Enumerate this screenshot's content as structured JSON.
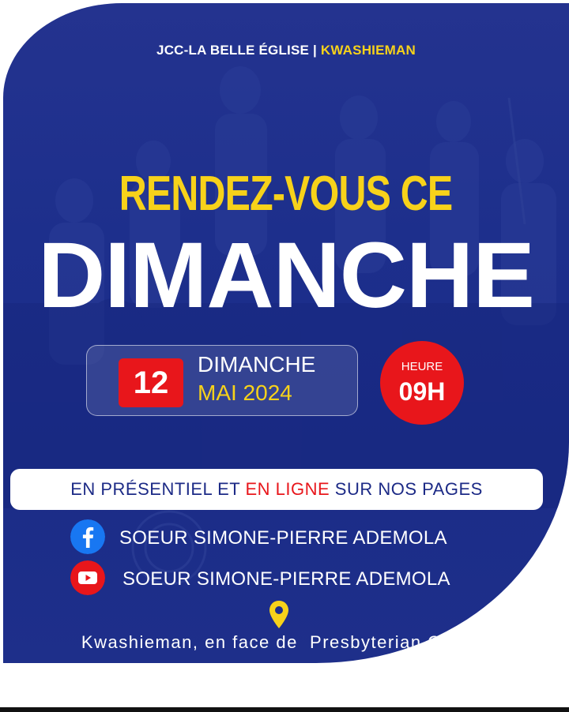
{
  "header": {
    "church": "JCC-LA BELLE ÉGLISE |",
    "location": "KWASHIEMAN"
  },
  "headline": {
    "line1": "RENDEZ-VOUS CE",
    "line2": "DIMANCHE"
  },
  "date": {
    "day": "12",
    "weekday": "DIMANCHE",
    "month_year": "MAI 2024"
  },
  "time": {
    "label": "HEURE",
    "value": "09H"
  },
  "mode": {
    "part1": "EN PRÉSENTIEL ET",
    "part2": "EN LIGNE",
    "part3": "SUR NOS PAGES"
  },
  "socials": [
    {
      "icon": "facebook-icon",
      "name": "SOEUR SIMONE-PIERRE ADEMOLA"
    },
    {
      "icon": "youtube-icon",
      "name": "SOEUR SIMONE-PIERRE ADEMOLA"
    }
  ],
  "address": {
    "icon": "map-pin-icon",
    "text": "Kwashieman, en face de  Presbyterian Church"
  },
  "colors": {
    "blue": "#1d2f8c",
    "yellow": "#f7d21a",
    "red": "#e8161b",
    "facebook": "#1877f2",
    "white": "#ffffff"
  }
}
